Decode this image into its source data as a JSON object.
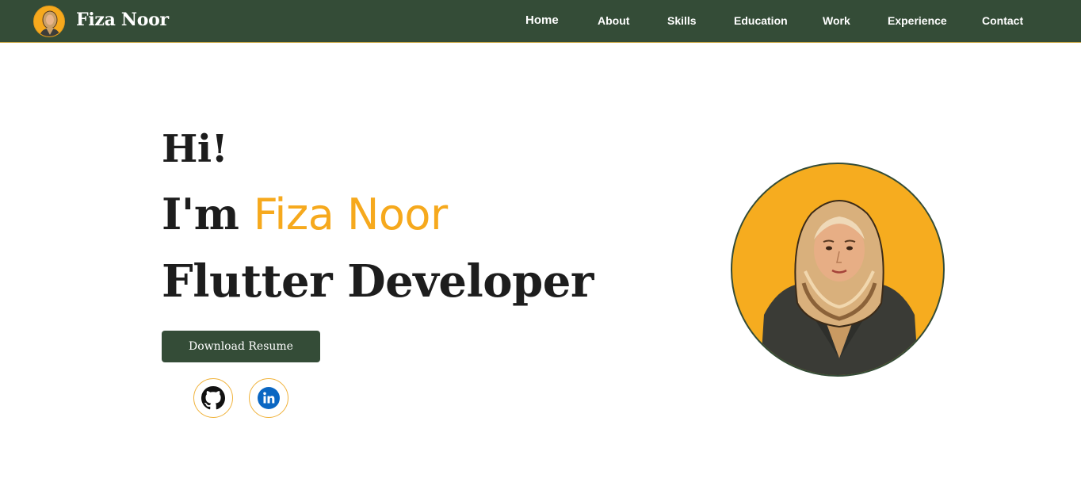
{
  "navbar": {
    "brand_name": "Fiza Noor",
    "logo_icon": "avatar-icon",
    "links": [
      {
        "label": "Home",
        "active": true
      },
      {
        "label": "About"
      },
      {
        "label": "Skills"
      },
      {
        "label": "Education"
      },
      {
        "label": "Work"
      },
      {
        "label": "Experience"
      },
      {
        "label": "Contact"
      }
    ]
  },
  "hero": {
    "greeting": "Hi!",
    "intro_prefix": "I'm ",
    "name": "Fiza Noor",
    "role": "Flutter Developer",
    "resume_button": "Download Resume",
    "socials": [
      {
        "icon": "github-icon"
      },
      {
        "icon": "linkedin-icon"
      }
    ],
    "portrait_icon": "profile-portrait"
  },
  "colors": {
    "nav_bg": "#344c37",
    "accent": "#f6a91d",
    "text": "#1d1d1d",
    "linkedin": "#0a66c2"
  }
}
